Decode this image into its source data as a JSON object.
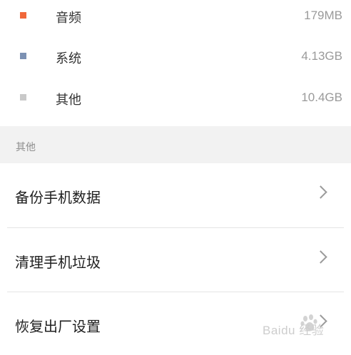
{
  "storage": {
    "items": [
      {
        "name": "音频",
        "size": "179MB",
        "color": "#f0683a"
      },
      {
        "name": "系统",
        "size": "4.13GB",
        "color": "#7c91b3"
      },
      {
        "name": "其他",
        "size": "10.4GB",
        "color": "#c9c9c9"
      }
    ]
  },
  "section": {
    "header": "其他"
  },
  "menu": {
    "items": [
      {
        "label": "备份手机数据",
        "icon": "chevron-right-icon"
      },
      {
        "label": "清理手机垃圾",
        "icon": "chevron-right-icon"
      },
      {
        "label": "恢复出厂设置",
        "icon": "chevron-right-icon"
      }
    ]
  },
  "watermark": {
    "text": "Baidu 经验"
  },
  "colors": {
    "background": "#ffffff",
    "section_background": "#f2f2f2",
    "chevron": "#9b9b9b",
    "divider": "#e4e4e4"
  }
}
